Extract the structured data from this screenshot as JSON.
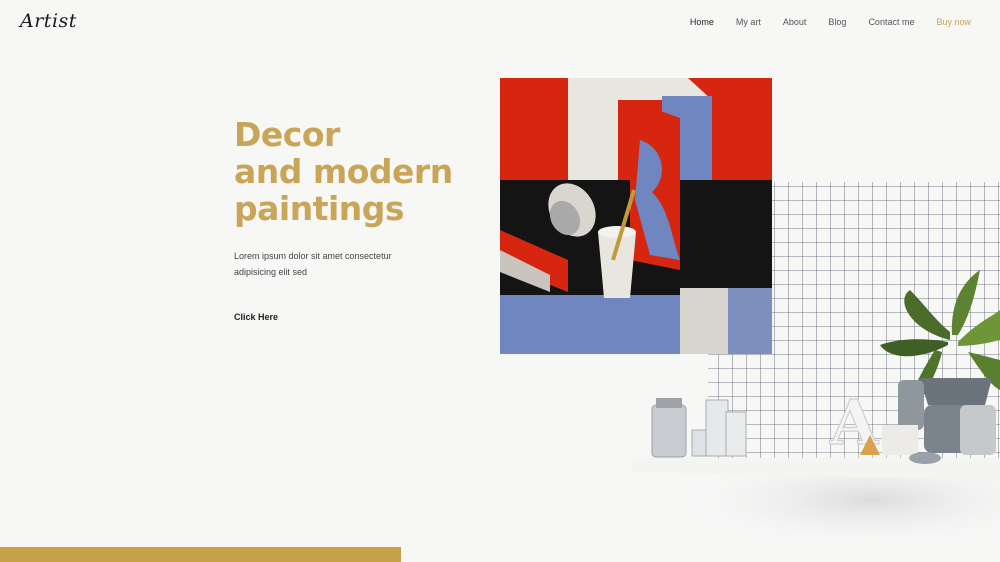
{
  "brand": {
    "logo": "Artist"
  },
  "nav": {
    "items": [
      {
        "label": "Home"
      },
      {
        "label": "My art"
      },
      {
        "label": "About"
      },
      {
        "label": "Blog"
      },
      {
        "label": "Contact me"
      },
      {
        "label": "Buy now"
      }
    ]
  },
  "hero": {
    "title_lines": [
      "Decor",
      "and modern",
      "paintings"
    ],
    "text": "Lorem ipsum dolor sit amet consectetur adipisicing elit sed",
    "cta": "Click Here"
  },
  "colors": {
    "accent": "#c9a558",
    "gold_bar": "#c7a04a",
    "painting_red": "#d7260f",
    "painting_blue": "#6f86c0",
    "painting_black": "#141414"
  },
  "icons": {
    "letter_sculpture": "A"
  }
}
